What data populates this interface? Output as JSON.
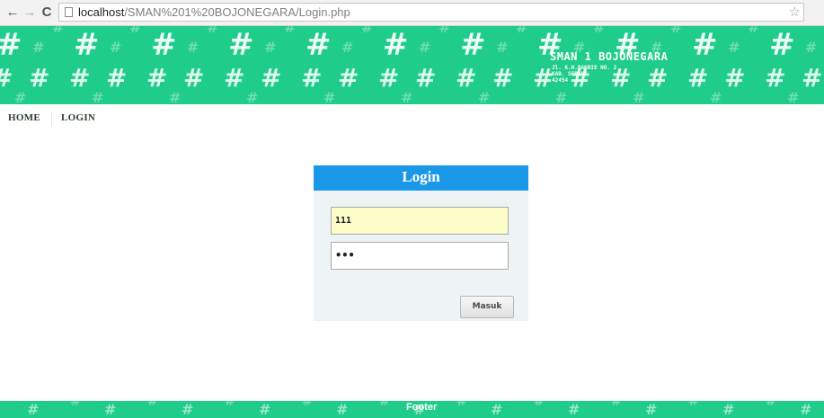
{
  "browser": {
    "url_host": "localhost",
    "url_path": "/SMAN%201%20BOJONEGARA/Login.php",
    "icons": {
      "back": "back-arrow-icon",
      "forward": "forward-arrow-icon",
      "reload": "reload-icon",
      "page": "page-icon",
      "bookmark": "star-icon"
    }
  },
  "header": {
    "school_name": "SMAN 1 BOJONEGARA",
    "address_line1": "Jl. K.H.BAKRIE NO. 2",
    "address_line2": "KAB. SERANG",
    "address_line3": "42454",
    "pattern_glyph": "#",
    "bg_color": "#1fcc8a"
  },
  "menu": {
    "items": [
      {
        "label": "HOME"
      },
      {
        "label": "LOGIN"
      }
    ]
  },
  "login": {
    "title": "Login",
    "username_value": "111",
    "password_value": "•••",
    "submit_label": "Masuk",
    "header_color": "#1a97e6"
  },
  "footer": {
    "label": "Footer"
  }
}
